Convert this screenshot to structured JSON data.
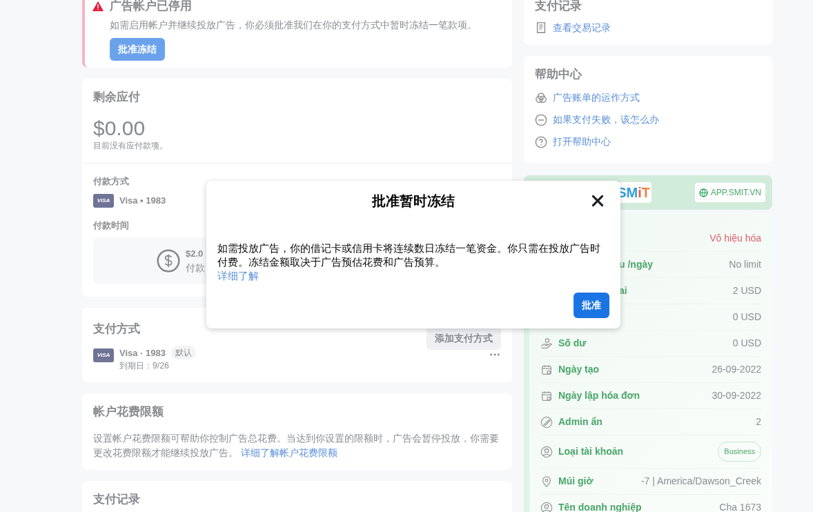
{
  "alert": {
    "title": "广告帐户已停用",
    "message": "如需启用帐户并继续投放广告，你必须批准我们在你的支付方式中暂时冻结一笔款项。",
    "button": "批准冻结"
  },
  "balance": {
    "title": "剩余应付",
    "amount": "$0.00",
    "note": "目前没有应付款项。",
    "method_label": "付款方式",
    "method": {
      "brand": "VISA",
      "text": "Visa • 1983"
    },
    "time_label": "付款时间",
    "schedule": {
      "amount": "$2.0",
      "text": "付款"
    }
  },
  "payment_methods": {
    "title": "支付方式",
    "add_button": "添加支付方式",
    "cards": [
      {
        "brand": "VISA",
        "text": "Visa · 1983",
        "badge": "默认",
        "expiry": "到期日：9/26"
      }
    ]
  },
  "spending_limit": {
    "title": "帐户花费限额",
    "text": "设置帐户花费限额可帮助你控制广告总花费。当达到你设置的限额时，广告会暂停投放，你需要更改花费限额才能继续投放广告。",
    "link": "详细了解帐户花费限额"
  },
  "payment_history_left": {
    "title": "支付记录"
  },
  "payment_history": {
    "title": "支付记录",
    "link": "查看交易记录"
  },
  "help_center": {
    "title": "帮助中心",
    "links": [
      "广告账单的运作方式",
      "如果支付失败，该怎么办",
      "打开帮助中心"
    ]
  },
  "account_panel": {
    "logo": "SMiT",
    "site_button": "APP.SMIT.VN",
    "rows": [
      {
        "kind": "status",
        "value": "Vô hiệu hóa"
      },
      {
        "covered": true,
        "kind": "text",
        "label": "u /ngày",
        "value": "No limit"
      },
      {
        "covered": true,
        "kind": "text",
        "label": "ai",
        "value": "2 USD"
      },
      {
        "kind": "text",
        "value": "0 USD"
      },
      {
        "covered": false,
        "kind": "text",
        "label": "Số dư",
        "value": "0 USD"
      },
      {
        "covered": false,
        "kind": "text",
        "label": "Ngày tạo",
        "value": "26-09-2022"
      },
      {
        "covered": false,
        "kind": "text",
        "label": "Ngày lập hóa đơn",
        "value": "30-09-2022"
      },
      {
        "covered": false,
        "kind": "text",
        "label": "Admin ẩn",
        "value": "2"
      },
      {
        "covered": false,
        "kind": "badge",
        "label": "Loại tài khoản",
        "value": "Business"
      },
      {
        "covered": false,
        "kind": "text",
        "label": "Múi giờ",
        "value": "-7 | America/Dawson_Creek"
      },
      {
        "covered": false,
        "kind": "text",
        "label": "Tên doanh nghiệp",
        "value": "Cha 1673"
      }
    ]
  },
  "dialog": {
    "title": "批准暂时冻结",
    "text": "如需投放广告，你的借记卡或信用卡将连续数日冻结一笔资金。你只需在投放广告时付费。冻结金额取决于广告预估花费和广告预算。",
    "link": "详细了解",
    "button": "批准"
  }
}
